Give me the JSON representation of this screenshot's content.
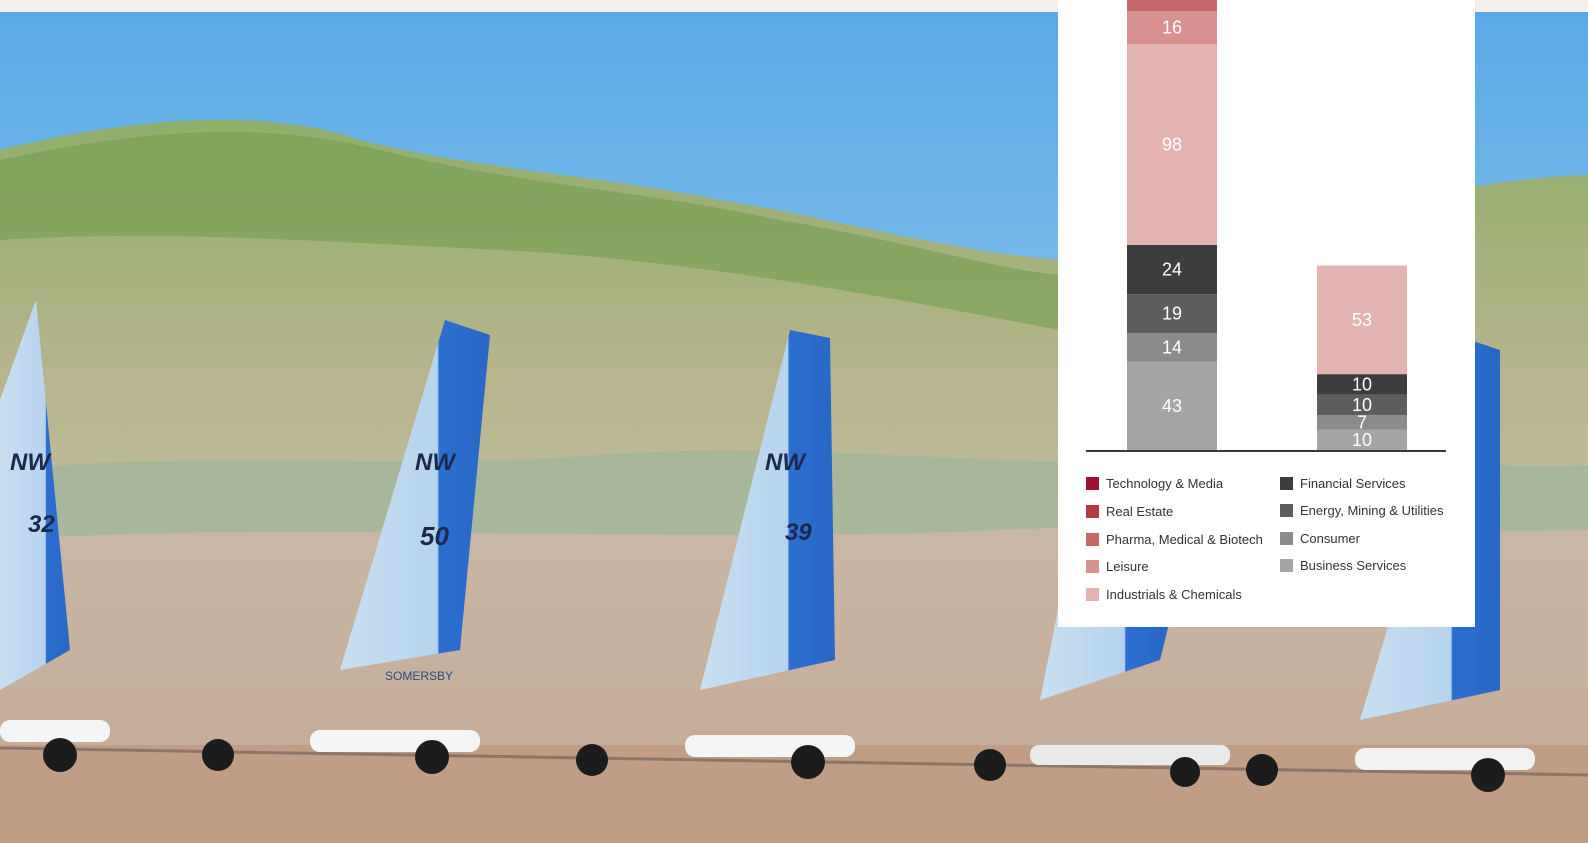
{
  "chart_data": {
    "type": "bar",
    "stacked": true,
    "categories": [
      "",
      ""
    ],
    "series": [
      {
        "name": "Business Services",
        "color": "#a6a4a5",
        "values": [
          43,
          10
        ]
      },
      {
        "name": "Consumer",
        "color": "#8c8a8b",
        "values": [
          14,
          7
        ]
      },
      {
        "name": "Energy, Mining & Utilities",
        "color": "#5e5c5d",
        "values": [
          19,
          10
        ]
      },
      {
        "name": "Financial Services",
        "color": "#3d3d3d",
        "values": [
          24,
          10
        ]
      },
      {
        "name": "Industrials & Chemicals",
        "color": "#e3b3b1",
        "values": [
          98,
          53
        ]
      },
      {
        "name": "Leisure",
        "color": "#d79290",
        "values": [
          16,
          null
        ]
      },
      {
        "name": "Pharma, Medical & Biotech",
        "color": "#c56a6a",
        "values": [
          null,
          null
        ]
      },
      {
        "name": "Real Estate",
        "color": "#b33a45",
        "values": [
          null,
          null
        ]
      },
      {
        "name": "Technology & Media",
        "color": "#a0102f",
        "values": [
          null,
          null
        ]
      }
    ],
    "legend_position": "bottom",
    "grid": false
  },
  "legend": {
    "left": [
      "Technology & Media",
      "Real Estate",
      "Pharma, Medical & Biotech",
      "Leisure",
      "Industrials & Chemicals"
    ],
    "right": [
      "Financial Services",
      "Energy, Mining & Utilities",
      "Consumer",
      "Business Services"
    ]
  },
  "background": {
    "image": "beach-land-yachts-photo",
    "sail_numbers": [
      "32",
      "50",
      "39"
    ],
    "sail_letters": "NW",
    "sponsor": "SOMERSBY"
  }
}
